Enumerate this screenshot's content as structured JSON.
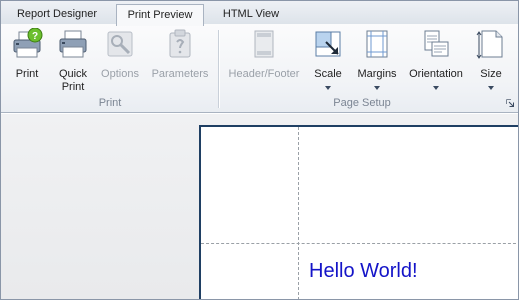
{
  "tabs": [
    {
      "label": "Report Designer",
      "active": false
    },
    {
      "label": "Print Preview",
      "active": true
    },
    {
      "label": "HTML View",
      "active": false
    }
  ],
  "ribbon": {
    "groups": {
      "print": "Print",
      "page_setup": "Page Setup"
    },
    "buttons": {
      "print": "Print",
      "quick_print": "Quick\nPrint",
      "options": "Options",
      "parameters": "Parameters",
      "header_footer": "Header/Footer",
      "scale": "Scale",
      "margins": "Margins",
      "orientation": "Orientation",
      "size": "Size"
    }
  },
  "document": {
    "content_text": "Hello World!"
  },
  "colors": {
    "content_text": "#1414c8",
    "page_border": "#1f3f63"
  }
}
